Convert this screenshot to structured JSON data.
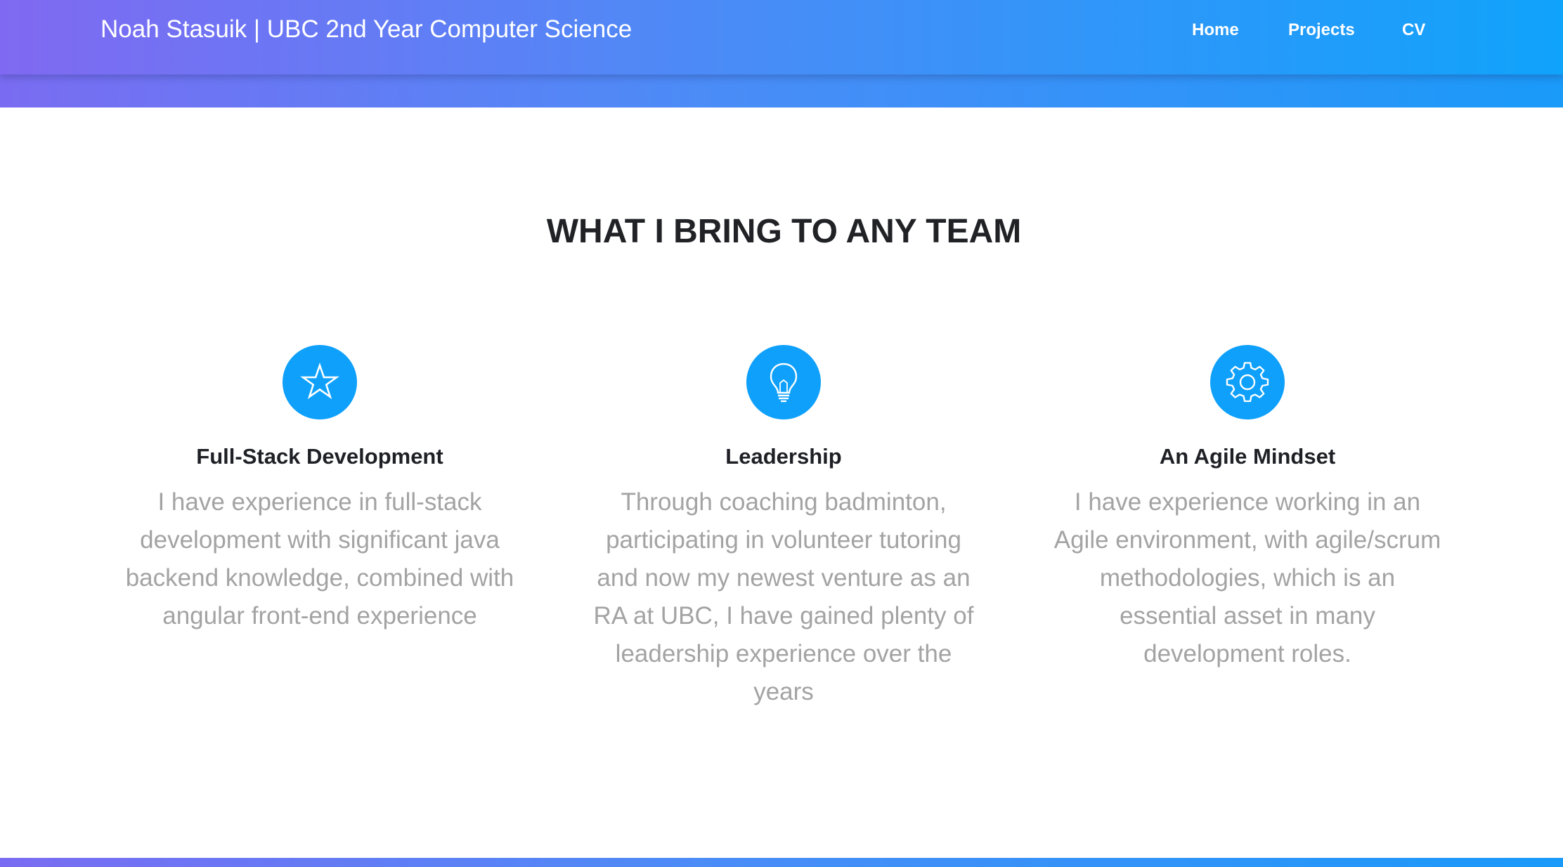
{
  "navbar": {
    "brand": "Noah Stasuik | UBC 2nd Year Computer Science",
    "links": [
      {
        "label": "Home"
      },
      {
        "label": "Projects"
      },
      {
        "label": "CV"
      }
    ]
  },
  "section": {
    "title": "WHAT I BRING TO ANY TEAM",
    "features": [
      {
        "icon": "star-icon",
        "title": "Full-Stack Development",
        "text": "I have experience in full-stack development with significant java backend knowledge, combined with angular front-end experience"
      },
      {
        "icon": "lightbulb-icon",
        "title": "Leadership",
        "text": "Through coaching badminton, participating in volunteer tutoring and now my newest venture as an RA at UBC, I have gained plenty of leadership experience over the years"
      },
      {
        "icon": "gear-icon",
        "title": "An Agile Mindset",
        "text": "I have experience working in an Agile environment, with agile/scrum methodologies, which is an essential asset in many development roles."
      }
    ]
  },
  "colors": {
    "gradient_start": "#8069f2",
    "gradient_end": "#10a3fb",
    "icon_accent": "#0ea0fb",
    "heading": "#202226",
    "body_text": "#a3a3a3"
  }
}
